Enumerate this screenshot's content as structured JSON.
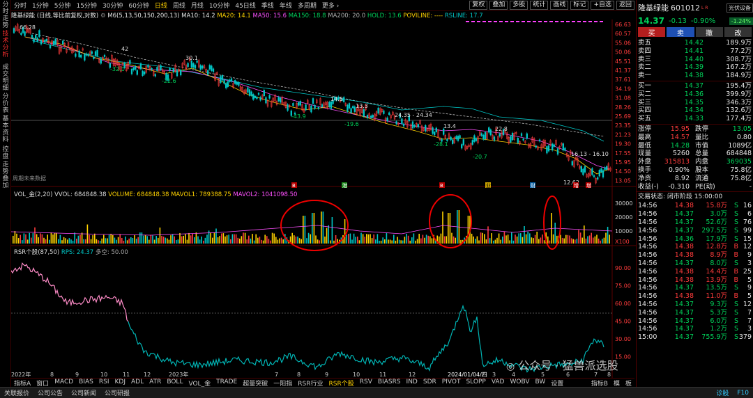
{
  "sidebar": {
    "tabs": [
      "分时走势",
      "技术分析",
      "成交明细",
      "分价表",
      "基本资料",
      "控盘",
      "走势叠加"
    ]
  },
  "topbar": {
    "periods": [
      "分时",
      "1分钟",
      "5分钟",
      "15分钟",
      "30分钟",
      "60分钟",
      "日线",
      "周线",
      "月线",
      "10分钟",
      "45日线",
      "季线",
      "年线",
      "多周期",
      "更多 ›"
    ],
    "active_period": "日线",
    "buttons": [
      "复权",
      "叠加",
      "多股",
      "统计",
      "画线",
      "标记",
      "+自选",
      "返回"
    ]
  },
  "main_title": {
    "stock": "隆基绿能 (日线,等比前复权,对数)",
    "m6": "M6(5,13,50,150,200,13)",
    "ma10": "MA10: 14.2",
    "ma20": "MA20: 14.1",
    "ma50": "MA50: 15.6",
    "ma150": "MA150: 18.8",
    "ma200": "MA200: 20.0",
    "hold": "HOLD: 13.6",
    "poviline": "POVILINE: ----",
    "rsline": "RSLINE: 17.7"
  },
  "price_axis": [
    "66.63",
    "60.57",
    "55.06",
    "50.06",
    "45.51",
    "41.37",
    "37.61",
    "34.19",
    "31.08",
    "28.26",
    "25.69",
    "23.35",
    "21.23",
    "19.30",
    "17.55",
    "15.95",
    "14.50",
    "13.05"
  ],
  "annotations": {
    "high": "66.28",
    "lows": [
      "-32.1",
      "-22.6",
      "-43.9",
      "-19.6",
      "-28.1",
      "-20.7"
    ],
    "mids": [
      "42",
      "30.1",
      "14.5",
      "13.3",
      "13.4",
      "22.8"
    ],
    "range1": "24.35 - 24.34",
    "range2": "16.13 - 16.10",
    "low_final": "12.62",
    "no_data": "周期未来数据"
  },
  "markers": [
    "B",
    "港",
    "B",
    "业",
    "财",
    "增"
  ],
  "vol": {
    "title": "VOL_金(2,20)",
    "vvol": "VVOL: 684848.38",
    "volume": "VOLUME: 684848.38",
    "mavol1": "MAVOL1: 789388.75",
    "mavol2": "MAVOL2: 1041098.50",
    "axis": [
      "30000",
      "20000",
      "10000"
    ],
    "unit": "X100"
  },
  "rsr": {
    "title": "RSR个股(87,50)",
    "rps": "RPS: 24.37",
    "duokong": "多空: 50.00",
    "axis": [
      "90.00",
      "75.00",
      "60.00",
      "45.00",
      "30.00",
      "15.00"
    ]
  },
  "time_axis": [
    "2022年",
    "8",
    "9",
    "10",
    "11",
    "12",
    "2023年",
    "7",
    "8",
    "9",
    "10",
    "11",
    "12",
    "2024/01/04/四",
    "3",
    "4",
    "5",
    "6",
    "7",
    "8"
  ],
  "bottom_tabs": [
    "指标A",
    "窗口",
    "MACD",
    "BIAS",
    "RSI",
    "KDJ",
    "ADL",
    "ATR",
    "BOLL",
    "VOL_金",
    "TRADE",
    "超量突破",
    "一阳指",
    "RSR行业",
    "RSR个股",
    "RSV",
    "BIASRS",
    "IND",
    "SDR",
    "PIVOT",
    "SLOPP",
    "VAD",
    "WOBV",
    "BW",
    "设置"
  ],
  "bottom_tabs_right": [
    "指标B",
    "模",
    "板"
  ],
  "active_bottom_tab": "RSR个股",
  "right": {
    "name": "隆基绿能",
    "code": "601012",
    "badge": "光伏设备",
    "badge_pct": "-1.24%",
    "price": "14.37",
    "change": "-0.13",
    "pct": "-0.90%",
    "actions": [
      "买",
      "卖",
      "撤",
      "改"
    ],
    "asks": [
      {
        "l": "卖五",
        "p": "14.42",
        "v": "189.9万"
      },
      {
        "l": "卖四",
        "p": "14.41",
        "v": "77.2万"
      },
      {
        "l": "卖三",
        "p": "14.40",
        "v": "308.7万"
      },
      {
        "l": "卖二",
        "p": "14.39",
        "v": "167.2万"
      },
      {
        "l": "卖一",
        "p": "14.38",
        "v": "184.9万"
      }
    ],
    "bids": [
      {
        "l": "买一",
        "p": "14.37",
        "v": "195.4万"
      },
      {
        "l": "买二",
        "p": "14.36",
        "v": "399.9万"
      },
      {
        "l": "买三",
        "p": "14.35",
        "v": "346.3万"
      },
      {
        "l": "买四",
        "p": "14.34",
        "v": "132.6万"
      },
      {
        "l": "买五",
        "p": "14.33",
        "v": "177.4万"
      }
    ],
    "stats": [
      {
        "a": "涨停",
        "av": "15.95",
        "b": "跌停",
        "bv": "13.05"
      },
      {
        "a": "最高",
        "av": "14.57",
        "b": "量比",
        "bv": "0.80"
      },
      {
        "a": "最低",
        "av": "14.28",
        "b": "市值",
        "bv": "1089亿"
      },
      {
        "a": "现量",
        "av": "5260",
        "b": "总量",
        "bv": "684848"
      },
      {
        "a": "外盘",
        "av": "315813",
        "b": "内盘",
        "bv": "369035"
      },
      {
        "a": "换手",
        "av": "0.90%",
        "b": "股本",
        "bv": "75.8亿"
      },
      {
        "a": "净资",
        "av": "8.92",
        "b": "流通",
        "bv": "75.8亿"
      },
      {
        "a": "收益(-)",
        "av": "-0.310",
        "b": "PE(动)",
        "bv": "-"
      }
    ],
    "trade_status": "交易状态: 闭市阶段 15:00:00",
    "ticks": [
      {
        "t": "14:56",
        "p": "14.38",
        "v": "15.8万",
        "s": "S",
        "n": "16"
      },
      {
        "t": "14:56",
        "p": "14.37",
        "v": "3.0万",
        "s": "S",
        "n": "6"
      },
      {
        "t": "14:56",
        "p": "14.37",
        "v": "52.6万",
        "s": "S",
        "n": "76"
      },
      {
        "t": "14:56",
        "p": "14.37",
        "v": "297.5万",
        "s": "S",
        "n": "99"
      },
      {
        "t": "14:56",
        "p": "14.36",
        "v": "17.9万",
        "s": "S",
        "n": "15"
      },
      {
        "t": "14:56",
        "p": "14.38",
        "v": "12.8万",
        "s": "B",
        "n": "12"
      },
      {
        "t": "14:56",
        "p": "14.38",
        "v": "8.9万",
        "s": "B",
        "n": "9"
      },
      {
        "t": "14:56",
        "p": "14.37",
        "v": "8.0万",
        "s": "S",
        "n": "3"
      },
      {
        "t": "14:56",
        "p": "14.38",
        "v": "14.4万",
        "s": "B",
        "n": "25"
      },
      {
        "t": "14:56",
        "p": "14.38",
        "v": "13.9万",
        "s": "B",
        "n": "5"
      },
      {
        "t": "14:56",
        "p": "14.37",
        "v": "13.5万",
        "s": "S",
        "n": "9"
      },
      {
        "t": "14:56",
        "p": "14.38",
        "v": "11.0万",
        "s": "B",
        "n": "5"
      },
      {
        "t": "14:56",
        "p": "14.37",
        "v": "9.3万",
        "s": "S",
        "n": "12"
      },
      {
        "t": "14:56",
        "p": "14.37",
        "v": "5.3万",
        "s": "S",
        "n": "7"
      },
      {
        "t": "14:56",
        "p": "14.37",
        "v": "6.0万",
        "s": "S",
        "n": "7"
      },
      {
        "t": "14:56",
        "p": "14.37",
        "v": "1.2万",
        "s": "S",
        "n": "3"
      },
      {
        "t": "15:00",
        "p": "14.37",
        "v": "755.9万",
        "s": "S",
        "n": "379"
      }
    ]
  },
  "status_bar": {
    "items": [
      "关联报价",
      "公司公告",
      "公司新闻",
      "公司研报"
    ],
    "right": [
      "诊股",
      "F10"
    ]
  },
  "watermark": "公众号 · 猛兽派选股"
}
